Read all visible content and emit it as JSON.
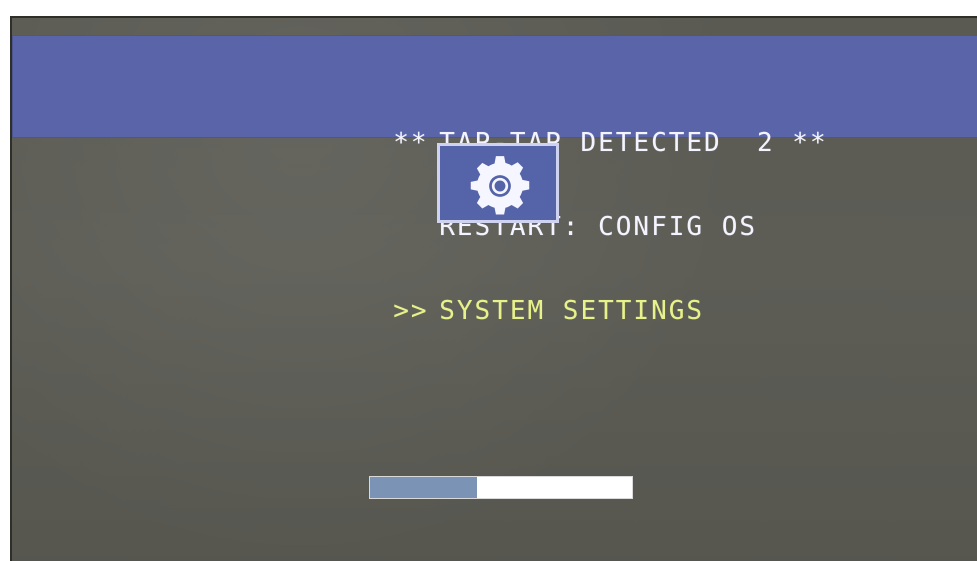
{
  "screen": {
    "header": {
      "lines": [
        {
          "prefix": "**",
          "text": "TAP-TAP DETECTED  2 **"
        },
        {
          "prefix": "",
          "text": "RESTART: CONFIG OS"
        },
        {
          "prefix": ">>",
          "text": "SYSTEM SETTINGS"
        }
      ]
    },
    "icon": {
      "name": "gear-icon"
    },
    "progress": {
      "value": 0.41
    }
  },
  "colors": {
    "background": "#5a5a53",
    "header": "#5a64a8",
    "header_text": "#f3f4ff",
    "selected_text": "#e7f28a",
    "icon_tile": "#5563a8",
    "icon_border": "#cfd3ef",
    "progress_track": "#ffffff",
    "progress_fill": "#7b93b4"
  }
}
